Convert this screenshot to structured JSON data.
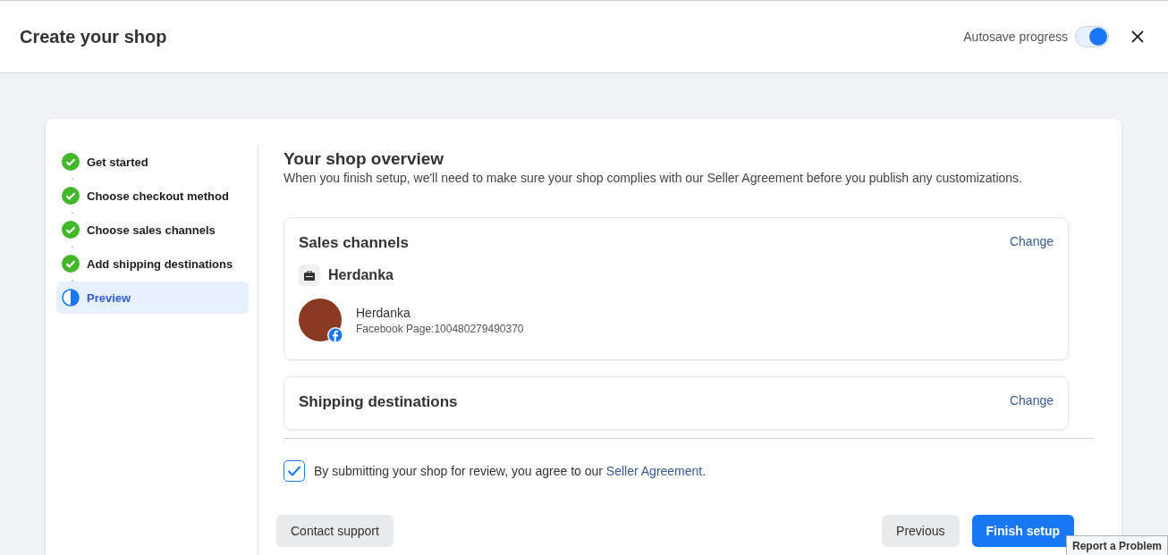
{
  "header": {
    "title": "Create your shop",
    "autosave": {
      "label": "Autosave progress",
      "on": true
    }
  },
  "steps": [
    {
      "label": "Get started",
      "kind": "done",
      "selected": false
    },
    {
      "label": "Choose checkout method",
      "kind": "done",
      "selected": false
    },
    {
      "label": "Choose sales channels",
      "kind": "done",
      "selected": false
    },
    {
      "label": "Add shipping destinations",
      "kind": "done",
      "selected": false
    },
    {
      "label": "Preview",
      "kind": "current",
      "selected": true
    }
  ],
  "overview": {
    "title": "Your shop overview",
    "description": "When you finish setup, we'll need to make sure your shop complies with our Seller Agreement before you publish any customizations."
  },
  "sections": [
    {
      "title": "Sales channels",
      "action": "Change",
      "shop": "Herdanka",
      "page": {
        "name": "Herdanka",
        "detail": "Facebook Page:100480279490370"
      }
    },
    {
      "title": "Shipping destinations",
      "action": "Change"
    }
  ],
  "agreement": {
    "checked": true,
    "text": "By submitting your shop for review, you agree to our ",
    "link": "Seller Agreement",
    "end": "."
  },
  "buttons": {
    "support": "Contact support",
    "previous": "Previous",
    "finish": "Finish setup"
  },
  "report": "Report a Problem"
}
